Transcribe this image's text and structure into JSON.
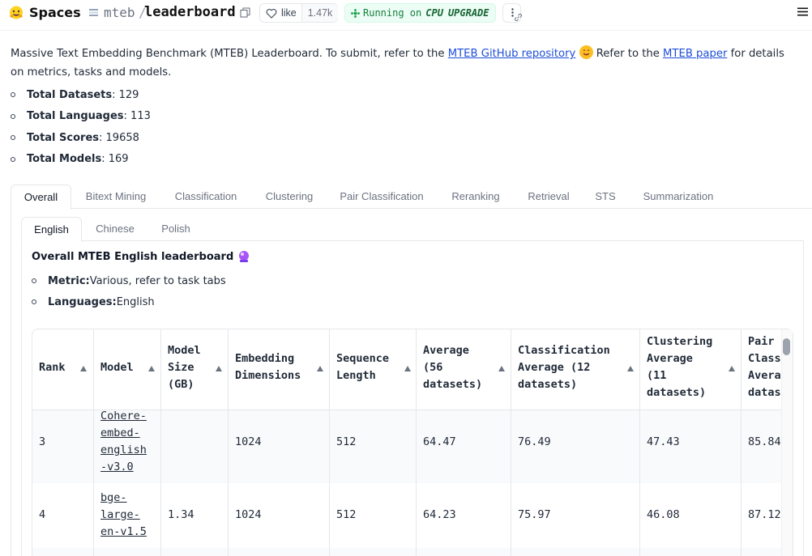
{
  "header": {
    "spaces_label": "Spaces",
    "org": "mteb",
    "separator": "/",
    "repo": "leaderboard",
    "like_label": "like",
    "like_count": "1.47k",
    "status_text": "Running on",
    "hardware": "CPU",
    "upgrade_label": "UPGRADE"
  },
  "intro": {
    "text_before_link1": "Massive Text Embedding Benchmark (MTEB) Leaderboard. To submit, refer to the ",
    "link1": "MTEB GitHub repository",
    "text_between": " Refer to the ",
    "link2": "MTEB paper",
    "text_after": " for details on metrics, tasks and models."
  },
  "stats": [
    {
      "label": "Total Datasets",
      "value": ": 129"
    },
    {
      "label": "Total Languages",
      "value": ": 113"
    },
    {
      "label": "Total Scores",
      "value": ": 19658"
    },
    {
      "label": "Total Models",
      "value": ": 169"
    }
  ],
  "outer_tabs": [
    "Overall",
    "Bitext Mining",
    "Classification",
    "Clustering",
    "Pair Classification",
    "Reranking",
    "Retrieval",
    "STS",
    "Summarization"
  ],
  "inner_tabs": [
    "English",
    "Chinese",
    "Polish"
  ],
  "leaderboard": {
    "title": "Overall MTEB English leaderboard",
    "metric_label": "Metric:",
    "metric_value": " Various, refer to task tabs",
    "languages_label": "Languages:",
    "languages_value": " English"
  },
  "table": {
    "headers": [
      [
        "Rank"
      ],
      [
        "Model"
      ],
      [
        "Model",
        "Size",
        "(GB)"
      ],
      [
        "Embedding",
        "Dimensions"
      ],
      [
        "Sequence",
        "Length"
      ],
      [
        "Average",
        "(56",
        "datasets)"
      ],
      [
        "Classification",
        "Average (12",
        "datasets)"
      ],
      [
        "Clustering",
        "Average",
        "(11",
        "datasets)"
      ],
      [
        "Pair",
        "Classi",
        "Avera",
        "datas"
      ]
    ],
    "rows": [
      {
        "rank": "3",
        "model": [
          "Cohere-",
          "embed-",
          "english",
          "-v3.0"
        ],
        "size": "",
        "dims": "1024",
        "seq": "512",
        "avg": "64.47",
        "cls": "76.49",
        "clu": "47.43",
        "pair": "85.84"
      },
      {
        "rank": "4",
        "model": [
          "bge-",
          "large-",
          "en-v1.5"
        ],
        "size": "1.34",
        "dims": "1024",
        "seq": "512",
        "avg": "64.23",
        "cls": "75.97",
        "clu": "46.08",
        "pair": "87.12"
      }
    ]
  },
  "colors": {
    "accent_link": "#1d4ed8",
    "status_green": "#15803d",
    "border": "#e5e7eb"
  }
}
